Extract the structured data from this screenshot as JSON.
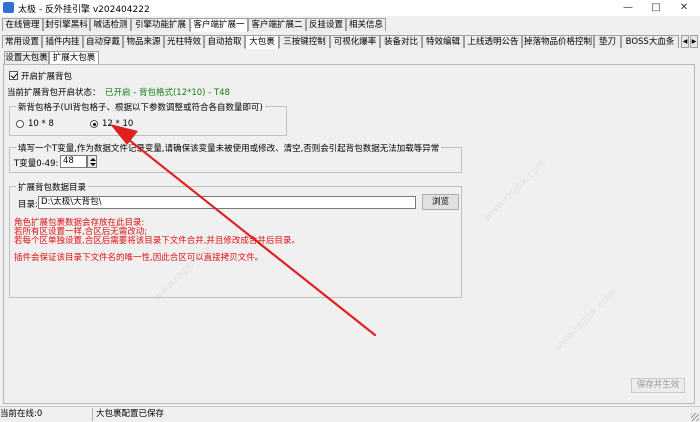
{
  "window": {
    "title": "太极 - 反外挂引擎 v202404222",
    "minimize": "—",
    "maximize": "□",
    "close": "✕"
  },
  "tabs_row1": [
    "在线管理",
    "封引擎黑科",
    "喊话检测",
    "引擎功能扩展",
    "客户端扩展一",
    "客户端扩展二",
    "反挂设置",
    "相关信息"
  ],
  "tabs_row1_active": 4,
  "tabs_row2": [
    "常用设置",
    "插件内挂",
    "自动穿戴",
    "物品来源",
    "光柱特效",
    "自动拾取",
    "大包裹",
    "三按键控制",
    "可视化爆率",
    "装备对比",
    "特效编辑",
    "上线透明公告",
    "掉落物品价格控制",
    "垫刀",
    "BOSS大血条"
  ],
  "tabs_row2_active": 6,
  "tabs_row3": [
    "设置大包裹",
    "扩展大包裹"
  ],
  "tabs_row3_active": 1,
  "enable_checkbox": {
    "label": "开启扩展背包",
    "checked": true
  },
  "status_line": {
    "label": "当前扩展背包开启状态：",
    "value": "已开启 - 背包格式(12*10) - T48"
  },
  "grid_group": {
    "title": "新背包格子(UI背包格子、根据以下参数调整或符合各自数量即可)",
    "options": [
      "10 * 8",
      "12 * 10"
    ],
    "selected": 1
  },
  "tvar_group": {
    "title": "填写一个T变量,作为数据文件记录变量,请确保该变量未被使用或修改、清空,否则会引起背包数据无法加载等异常",
    "label": "T变量0-49:",
    "value": "48"
  },
  "dir_group": {
    "title": "扩展背包数据目录",
    "label": "目录:",
    "value": "D:\\太极\\大背包\\",
    "browse": "浏览",
    "notes": [
      "角色扩展包裹数据会存放在此目录:",
      "若所有区设置一样,合区后无需改动;",
      "若每个区单独设置,合区后需要将该目录下文件合并,并且修改成合并后目录。"
    ],
    "note2": "插件会保证该目录下文件名的唯一性,因此合区可以直接拷贝文件。"
  },
  "save_button": "保存并生效",
  "statusbar": {
    "online": "当前在线:0",
    "message": "大包裹配置已保存"
  },
  "watermark": "www.rzgjbk.com"
}
